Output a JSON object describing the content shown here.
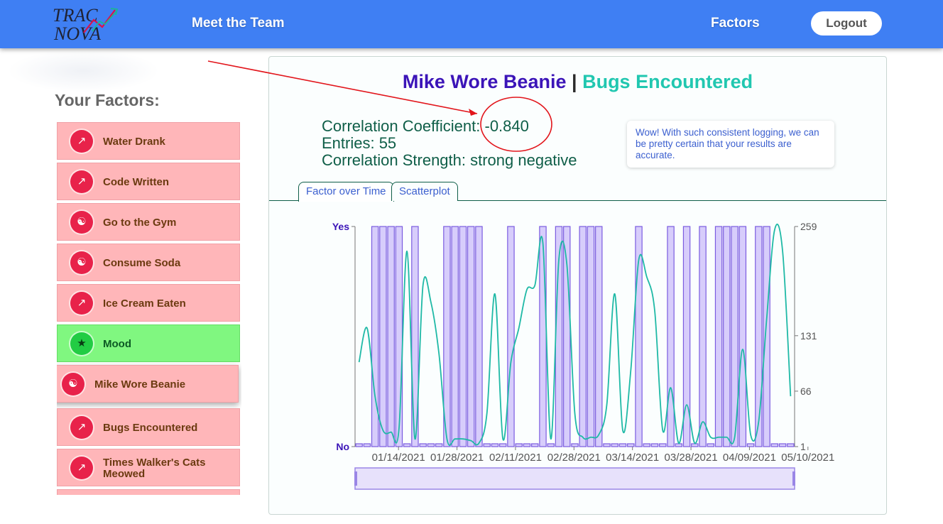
{
  "header": {
    "logo_text_top": "TRAC",
    "logo_text_bottom": "NOVA",
    "nav_team": "Meet the Team",
    "nav_factors": "Factors",
    "logout": "Logout"
  },
  "sidebar": {
    "title": "Your Factors:",
    "items": [
      {
        "label": "Water Drank",
        "icon": "trend-icon",
        "state": "normal"
      },
      {
        "label": "Code Written",
        "icon": "trend-icon",
        "state": "normal"
      },
      {
        "label": "Go to the Gym",
        "icon": "yinyang-icon",
        "state": "normal"
      },
      {
        "label": "Consume Soda",
        "icon": "yinyang-icon",
        "state": "normal"
      },
      {
        "label": "Ice Cream Eaten",
        "icon": "trend-icon",
        "state": "normal"
      },
      {
        "label": "Mood",
        "icon": "star-icon",
        "state": "green"
      },
      {
        "label": "Mike Wore Beanie",
        "icon": "yinyang-icon",
        "state": "selected"
      },
      {
        "label": "Bugs Encountered",
        "icon": "trend-icon",
        "state": "normal"
      },
      {
        "label": "Times Walker's Cats Meowed",
        "icon": "trend-icon",
        "state": "normal"
      }
    ]
  },
  "panel": {
    "title_a": "Mike Wore Beanie",
    "separator": "|",
    "title_b": "Bugs Encountered",
    "coef_label": "Correlation Coefficient:",
    "coef_value": "-0.840",
    "entries_text": "Entries: 55",
    "strength_text": "Correlation Strength: strong negative",
    "callout": "Wow! With such consistent logging, we can be pretty certain that your results are accurate.",
    "tabs": [
      "Factor over Time",
      "Scatterplot"
    ],
    "active_tab": 0
  },
  "colors": {
    "topbar": "#3f7ff3",
    "factor_card": "#ffb6b9",
    "factor_green": "#80f780",
    "title_a": "#3b14b8",
    "title_b": "#21c7b0",
    "bar_fill": "#d7cdfb",
    "bar_stroke": "#7b5ce0",
    "line": "#1fb9a6",
    "annotation": "#e2151b"
  },
  "chart_data": {
    "type": "bar",
    "left_axis": {
      "ticks": [
        "Yes",
        "No"
      ]
    },
    "right_axis": {
      "ticks": [
        259,
        131,
        66,
        1
      ],
      "ylim": [
        1,
        259
      ]
    },
    "x_ticks": [
      "01/14/2021",
      "01/28/2021",
      "02/11/2021",
      "02/28/2021",
      "03/14/2021",
      "03/28/2021",
      "04/09/2021",
      "05/10/2021"
    ],
    "series": [
      {
        "name": "Mike Wore Beanie",
        "type": "bar",
        "values": [
          0,
          0,
          1,
          1,
          1,
          1,
          0,
          1,
          0,
          0,
          0,
          1,
          1,
          1,
          1,
          1,
          0,
          0,
          0,
          1,
          0,
          0,
          0,
          1,
          0,
          1,
          1,
          0,
          1,
          1,
          1,
          0,
          0,
          0,
          0,
          1,
          0,
          0,
          0,
          1,
          0,
          1,
          0,
          1,
          0,
          1,
          1,
          1,
          1,
          0,
          1,
          1,
          0,
          0,
          0
        ]
      },
      {
        "name": "Bugs Encountered",
        "type": "line",
        "values": [
          100,
          140,
          60,
          20,
          18,
          22,
          230,
          10,
          190,
          170,
          110,
          10,
          10,
          10,
          8,
          5,
          40,
          180,
          10,
          100,
          140,
          185,
          190,
          240,
          10,
          220,
          215,
          40,
          12,
          12,
          15,
          50,
          180,
          20,
          90,
          220,
          200,
          160,
          20,
          70,
          5,
          50,
          5,
          30,
          12,
          12,
          12,
          12,
          115,
          15,
          30,
          150,
          255,
          230,
          60
        ]
      }
    ]
  }
}
